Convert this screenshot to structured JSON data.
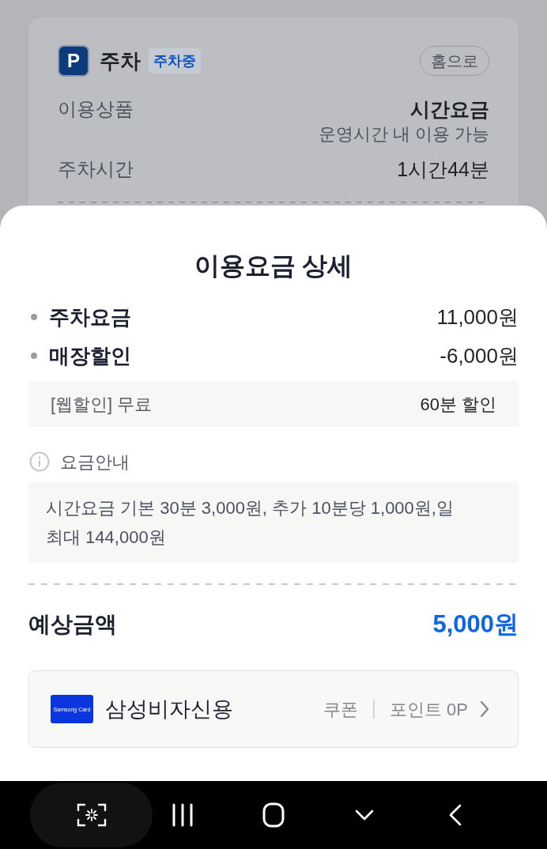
{
  "background_card": {
    "icon_letter": "P",
    "title": "주차",
    "status_badge": "주차중",
    "home_button": "홈으로",
    "rows": [
      {
        "label": "이용상품",
        "value": "시간요금",
        "note": "운영시간 내 이용 가능"
      },
      {
        "label": "주차시간",
        "value": "1시간44분"
      }
    ]
  },
  "sheet": {
    "title": "이용요금 상세",
    "fees": [
      {
        "label": "주차요금",
        "value": "11,000원"
      },
      {
        "label": "매장할인",
        "value": "-6,000원"
      }
    ],
    "discount_detail": {
      "label": "[웹할인] 무료",
      "value": "60분 할인"
    },
    "fee_info": {
      "heading": "요금안내",
      "text": "시간요금 기본 30분 3,000원, 추가 10분당 1,000원,일 최대 144,000원"
    },
    "estimate": {
      "label": "예상금액",
      "amount": "5,000원"
    },
    "payment": {
      "card_logo_text": "Samsung Card",
      "card_name": "삼성비자신용",
      "coupon": "쿠폰",
      "points": "포인트 0P"
    }
  },
  "nav_bar": [
    {
      "kind": "scan"
    },
    {
      "kind": "recents"
    },
    {
      "kind": "home"
    },
    {
      "kind": "hide_keyboard"
    },
    {
      "kind": "back"
    }
  ]
}
